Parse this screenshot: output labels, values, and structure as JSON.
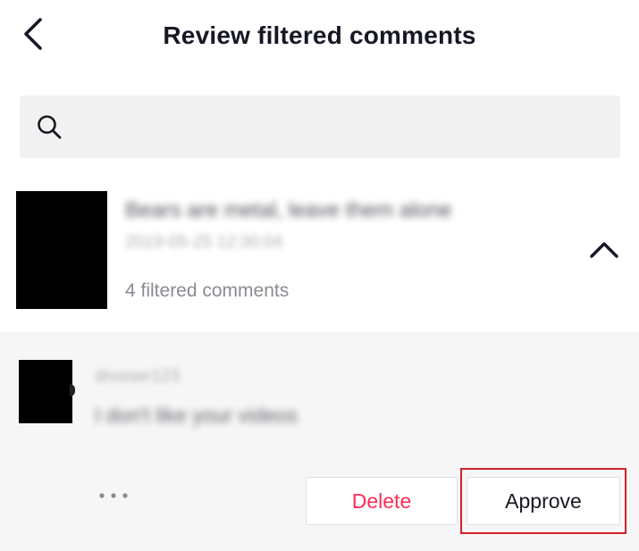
{
  "header": {
    "title": "Review filtered comments",
    "back_icon": "chevron-left-icon"
  },
  "search": {
    "placeholder": "",
    "value": "",
    "icon": "search-icon"
  },
  "video": {
    "caption": "Bears are metal, leave them alone",
    "date": "2019-05-25 12:30:04",
    "filtered_count": "4 filtered comments",
    "expand_icon": "chevron-up-icon"
  },
  "comment": {
    "username": "drusser123",
    "text": "I don't like your videos",
    "more_icon": "more-horizontal-icon"
  },
  "actions": {
    "delete_label": "Delete",
    "approve_label": "Approve"
  },
  "colors": {
    "accent": "#fe2c55",
    "highlight": "#d4202c",
    "panel_bg": "#f6f6f6",
    "search_bg": "#f1f1f2"
  }
}
